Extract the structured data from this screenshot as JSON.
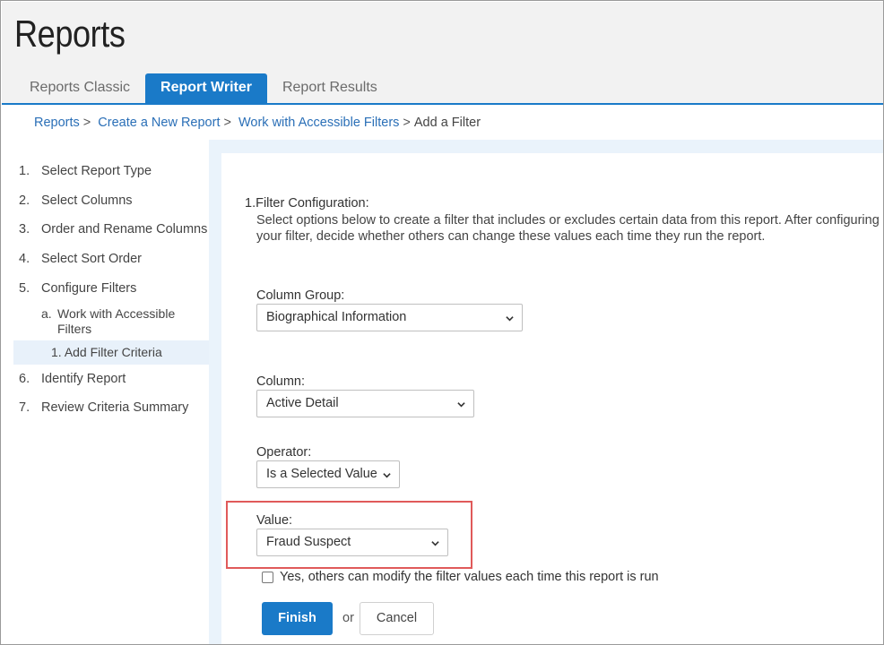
{
  "page": {
    "title": "Reports"
  },
  "tabs": [
    {
      "label": "Reports Classic",
      "active": false
    },
    {
      "label": "Report Writer",
      "active": true
    },
    {
      "label": "Report Results",
      "active": false
    }
  ],
  "breadcrumb": {
    "items": [
      "Reports",
      "Create a New Report",
      "Work with Accessible Filters"
    ],
    "current": "Add a Filter",
    "separator": ">"
  },
  "steps": [
    {
      "num": "1.",
      "label": "Select Report Type"
    },
    {
      "num": "2.",
      "label": "Select Columns"
    },
    {
      "num": "3.",
      "label": "Order and Rename Columns"
    },
    {
      "num": "4.",
      "label": "Select Sort Order"
    },
    {
      "num": "5.",
      "label": "Configure Filters"
    },
    {
      "num": "6.",
      "label": "Identify Report"
    },
    {
      "num": "7.",
      "label": "Review Criteria Summary"
    }
  ],
  "substeps": {
    "a": {
      "num": "a.",
      "label": "Work with Accessible Filters"
    },
    "a1": {
      "num": "1.",
      "label": "Add Filter Criteria"
    }
  },
  "section": {
    "title": "1.Filter Configuration:",
    "description": "Select options below to create a filter that includes or excludes certain data from this report. After configuring your filter, decide whether others can change these values each time they run the report."
  },
  "fields": {
    "column_group": {
      "label": "Column Group:",
      "value": "Biographical Information"
    },
    "column": {
      "label": "Column:",
      "value": "Active Detail"
    },
    "operator": {
      "label": "Operator:",
      "value": "Is a Selected Value"
    },
    "value": {
      "label": "Value:",
      "value": "Fraud Suspect"
    }
  },
  "allow_modify": {
    "label": "Yes, others can modify the filter values each time this report is run",
    "checked": false
  },
  "actions": {
    "finish": "Finish",
    "or": "or",
    "cancel": "Cancel"
  },
  "colors": {
    "accent": "#1a7ac8",
    "highlight": "#e05a5a",
    "link": "#2a6fb7"
  }
}
